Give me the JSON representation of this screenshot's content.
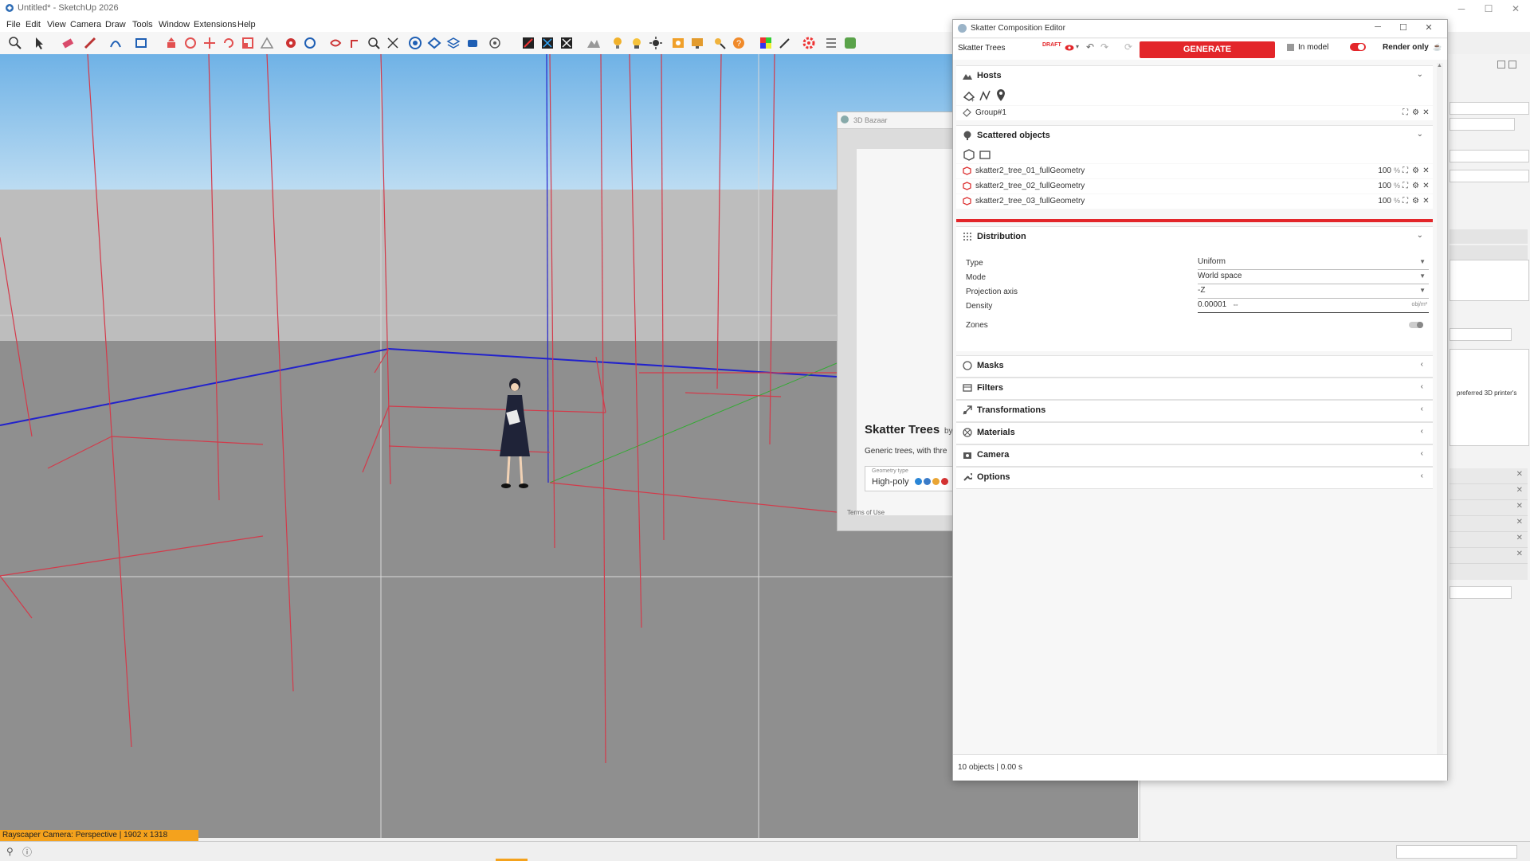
{
  "app": {
    "window_title": "Untitled* - SketchUp 2026",
    "menus": [
      "File",
      "Edit",
      "View",
      "Camera",
      "Draw",
      "Tools",
      "Window",
      "Extensions",
      "Help"
    ]
  },
  "viewport": {
    "status_label": "Rayscaper Camera: Perspective | 1902 x 1318"
  },
  "bazaar": {
    "window_title": "3D Bazaar",
    "product_title": "Skatter Trees",
    "by_label": "by",
    "description": "Generic trees, with thre",
    "geometry_type_label": "Geometry type",
    "geometry_type_value": "High-poly",
    "terms_link": "Terms of Use"
  },
  "tray": {
    "snippet_text": "preferred 3D printer's"
  },
  "editor": {
    "window_title": "Skatter Composition Editor",
    "composition_name": "Skatter Trees",
    "draft_badge": "DRAFT",
    "generate_label": "GENERATE",
    "in_model_label": "In model",
    "render_only_label": "Render only",
    "status_bar": "10 objects | 0.00 s",
    "accent_color": "#e3262a",
    "hosts": {
      "title": "Hosts",
      "items": [
        {
          "name": "Group#1"
        }
      ]
    },
    "scattered": {
      "title": "Scattered objects",
      "items": [
        {
          "name": "skatter2_tree_01_fullGeometry",
          "percent": "100",
          "unit": "%"
        },
        {
          "name": "skatter2_tree_02_fullGeometry",
          "percent": "100",
          "unit": "%"
        },
        {
          "name": "skatter2_tree_03_fullGeometry",
          "percent": "100",
          "unit": "%"
        }
      ]
    },
    "distribution": {
      "title": "Distribution",
      "type_label": "Type",
      "type_value": "Uniform",
      "mode_label": "Mode",
      "mode_value": "World space",
      "axis_label": "Projection axis",
      "axis_value": "-Z",
      "density_label": "Density",
      "density_value": "0.00001",
      "density_unit": "obj/m²",
      "zones_label": "Zones"
    },
    "collapsed_sections": [
      "Masks",
      "Filters",
      "Transformations",
      "Materials",
      "Camera",
      "Options"
    ]
  }
}
